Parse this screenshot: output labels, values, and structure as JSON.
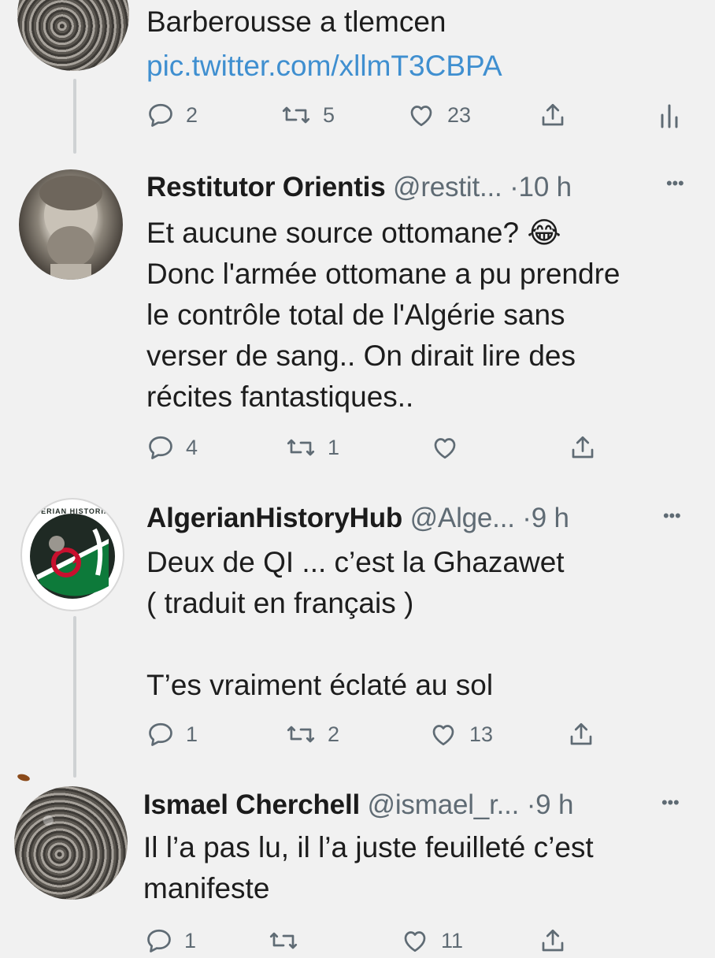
{
  "tweets": [
    {
      "body": [
        "Barberousse a tlemcen"
      ],
      "link": "pic.twitter.com/xllmT3CBPA",
      "actions": {
        "replies": "2",
        "retweets": "5",
        "likes": "23"
      }
    },
    {
      "name": "Restitutor Orientis",
      "handle": "@restit...",
      "time": "·10 h",
      "more": "•••",
      "body": [
        "Et aucune source ottomane? 😂",
        "Donc l'armée ottomane a pu prendre",
        "le contrôle total de l'Algérie sans",
        "verser de sang.. On dirait lire des",
        "récites fantastiques.."
      ],
      "actions": {
        "replies": "4",
        "retweets": "1",
        "likes": ""
      }
    },
    {
      "name": "AlgerianHistoryHub",
      "handle": "@Alge...",
      "time": "·9 h",
      "more": "•••",
      "avatar_text": "ALGERIAN HISTORIANS",
      "body": [
        "Deux de QI ... c’est la Ghazawet",
        "( traduit en français )",
        "",
        "T’es vraiment éclaté au sol"
      ],
      "actions": {
        "replies": "1",
        "retweets": "2",
        "likes": "13"
      }
    },
    {
      "name": "Ismael Cherchell",
      "handle": "@ismael_r...",
      "time": "·9 h",
      "more": "•••",
      "body": [
        "Il l’a pas lu, il l’a juste feuilleté c’est",
        "manifeste"
      ],
      "actions": {
        "replies": "1",
        "retweets": "",
        "likes": "11"
      }
    }
  ],
  "icons": {
    "reply": "reply-icon",
    "retweet": "retweet-icon",
    "like": "heart-icon",
    "share": "share-icon",
    "analytics": "analytics-icon"
  },
  "colors": {
    "background": "#f1f1f1",
    "link": "#3f8fd0",
    "secondary": "#5f6b74",
    "thread_line": "#cfd2d4",
    "flag_green": "#0d7a3a",
    "flag_red": "#c8102e"
  }
}
